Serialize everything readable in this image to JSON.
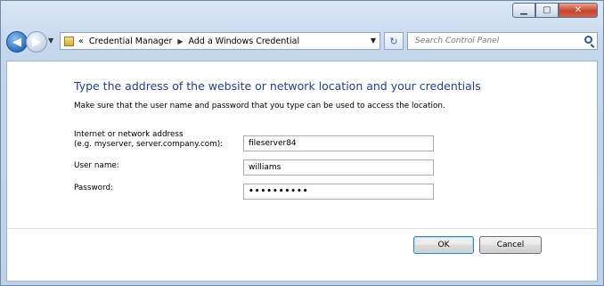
{
  "window": {
    "caption_buttons": {
      "minimize": "▁",
      "maximize": "▢",
      "close": "✕"
    }
  },
  "nav": {
    "back_icon": "◀",
    "forward_icon": "▶",
    "dropdown_icon": "▼",
    "address": {
      "overflow": "«",
      "crumbs": [
        "Credential Manager",
        "Add a Windows Credential"
      ],
      "separator": "▶",
      "dropdown_icon": "▼"
    },
    "refresh_icon": "↻",
    "search_placeholder": "Search Control Panel"
  },
  "form": {
    "heading": "Type the address of the website or network location and your credentials",
    "subtext": "Make sure that the user name and password that you type can be used to access the location.",
    "address_label_line1": "Internet or network address",
    "address_label_line2": "(e.g. myserver, server.company.com):",
    "address_value": "fileserver84",
    "username_label": "User name:",
    "username_value": "williams",
    "password_label": "Password:",
    "password_value": "••••••••••"
  },
  "buttons": {
    "ok": "OK",
    "cancel": "Cancel"
  },
  "colors": {
    "heading": "#1f3f9e",
    "window_frame": "#c4d6ec",
    "close_button": "#c7432c"
  }
}
